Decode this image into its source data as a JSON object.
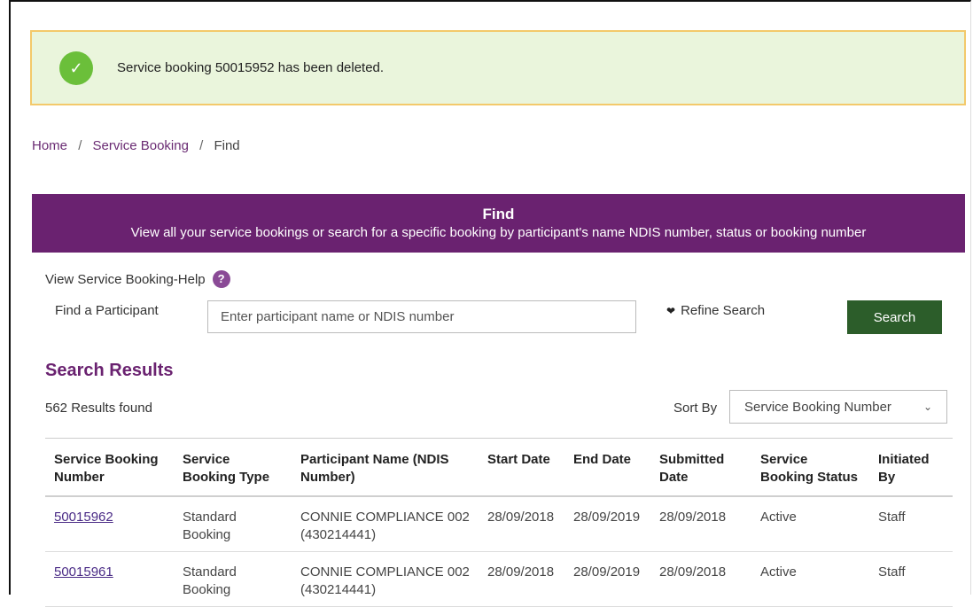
{
  "alert": {
    "message": "Service booking 50015952 has been deleted.",
    "icon": "check-icon",
    "color": "#6bbf3a"
  },
  "breadcrumb": {
    "home": "Home",
    "service_booking": "Service Booking",
    "current": "Find",
    "separator": "/"
  },
  "banner": {
    "title": "Find",
    "subtitle": "View all your service bookings or search for a specific booking by participant's name NDIS number, status or booking number",
    "color": "#6a2270"
  },
  "help": {
    "label": "View Service Booking-Help",
    "icon_glyph": "?"
  },
  "search": {
    "label": "Find a Participant",
    "placeholder": "Enter participant name or NDIS number",
    "value": "",
    "refine_label": "Refine Search",
    "button_label": "Search",
    "button_color": "#2c5d2a"
  },
  "results": {
    "title": "Search Results",
    "count_text": "562 Results found",
    "sort_label": "Sort By",
    "sort_value": "Service Booking Number",
    "columns": [
      "Service Booking Number",
      "Service Booking Type",
      "Participant Name (NDIS Number)",
      "Start Date",
      "End Date",
      "Submitted Date",
      "Service Booking Status",
      "Initiated By"
    ],
    "rows": [
      {
        "number": "50015962",
        "type": "Standard Booking",
        "participant": "CONNIE COMPLIANCE 002 (430214441)",
        "start": "28/09/2018",
        "end": "28/09/2019",
        "submitted": "28/09/2018",
        "status": "Active",
        "initiated": "Staff"
      },
      {
        "number": "50015961",
        "type": "Standard Booking",
        "participant": "CONNIE COMPLIANCE 002 (430214441)",
        "start": "28/09/2018",
        "end": "28/09/2019",
        "submitted": "28/09/2018",
        "status": "Active",
        "initiated": "Staff"
      }
    ]
  }
}
